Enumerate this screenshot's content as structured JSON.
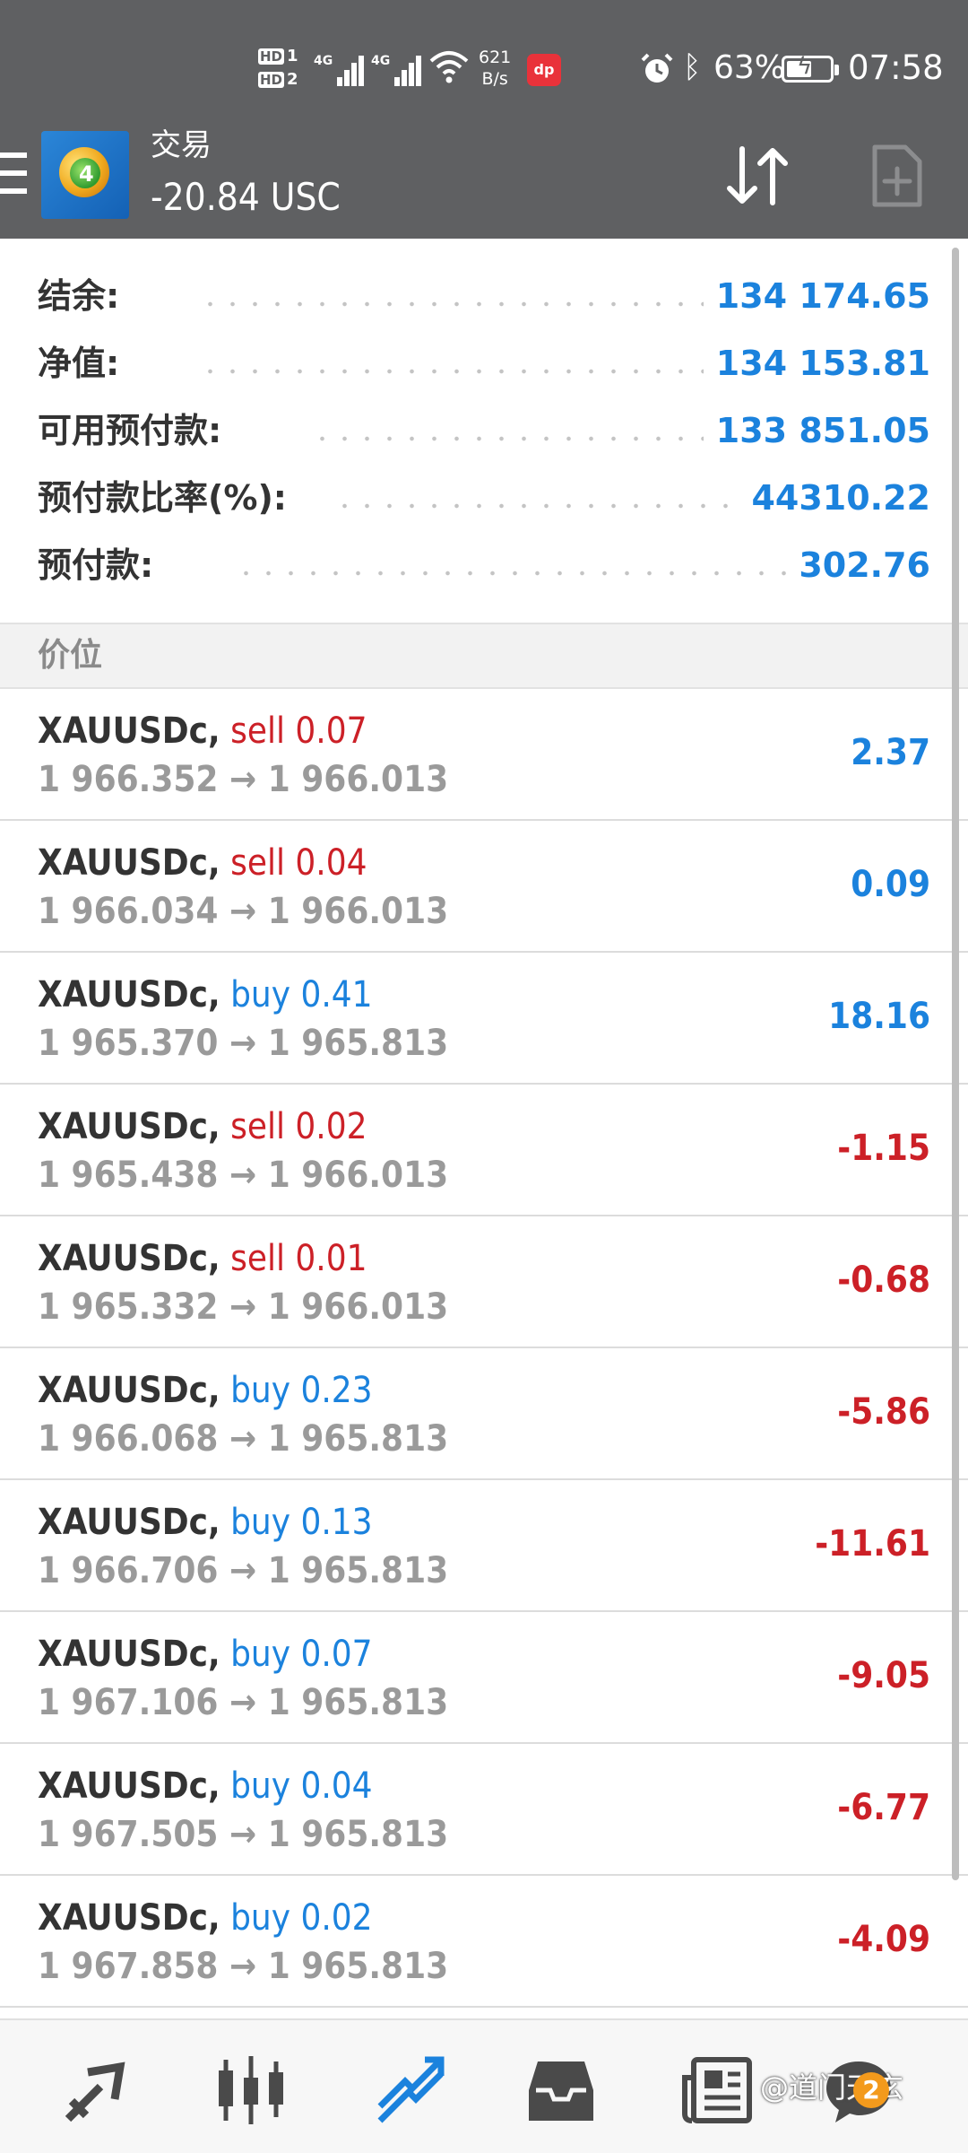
{
  "status_bar": {
    "hd1": "HD",
    "hd1_num": "1",
    "hd2": "HD",
    "hd2_num": "2",
    "net1": "4G",
    "net2": "4G",
    "speed_value": "621",
    "speed_unit": "B/s",
    "app_badge": "dp",
    "battery_pct": "63%",
    "battery_level": 0.63,
    "time": "07:58"
  },
  "toolbar": {
    "title": "交易",
    "balance": "-20.84 USC",
    "logo_num": "4"
  },
  "account": [
    {
      "label": "结余:",
      "value": "134 174.65"
    },
    {
      "label": "净值:",
      "value": "134 153.81"
    },
    {
      "label": "可用预付款:",
      "value": "133 851.05"
    },
    {
      "label": "预付款比率(%):",
      "value": "44310.22"
    },
    {
      "label": "预付款:",
      "value": "302.76"
    }
  ],
  "section_title": "价位",
  "positions": [
    {
      "symbol": "XAUUSDc,",
      "type": "sell",
      "lot": "0.07",
      "open": "1 966.352",
      "current": "1 966.013",
      "profit": "2.37",
      "sign": "pos"
    },
    {
      "symbol": "XAUUSDc,",
      "type": "sell",
      "lot": "0.04",
      "open": "1 966.034",
      "current": "1 966.013",
      "profit": "0.09",
      "sign": "pos"
    },
    {
      "symbol": "XAUUSDc,",
      "type": "buy",
      "lot": "0.41",
      "open": "1 965.370",
      "current": "1 965.813",
      "profit": "18.16",
      "sign": "pos"
    },
    {
      "symbol": "XAUUSDc,",
      "type": "sell",
      "lot": "0.02",
      "open": "1 965.438",
      "current": "1 966.013",
      "profit": "-1.15",
      "sign": "neg"
    },
    {
      "symbol": "XAUUSDc,",
      "type": "sell",
      "lot": "0.01",
      "open": "1 965.332",
      "current": "1 966.013",
      "profit": "-0.68",
      "sign": "neg"
    },
    {
      "symbol": "XAUUSDc,",
      "type": "buy",
      "lot": "0.23",
      "open": "1 966.068",
      "current": "1 965.813",
      "profit": "-5.86",
      "sign": "neg"
    },
    {
      "symbol": "XAUUSDc,",
      "type": "buy",
      "lot": "0.13",
      "open": "1 966.706",
      "current": "1 965.813",
      "profit": "-11.61",
      "sign": "neg"
    },
    {
      "symbol": "XAUUSDc,",
      "type": "buy",
      "lot": "0.07",
      "open": "1 967.106",
      "current": "1 965.813",
      "profit": "-9.05",
      "sign": "neg"
    },
    {
      "symbol": "XAUUSDc,",
      "type": "buy",
      "lot": "0.04",
      "open": "1 967.505",
      "current": "1 965.813",
      "profit": "-6.77",
      "sign": "neg"
    },
    {
      "symbol": "XAUUSDc,",
      "type": "buy",
      "lot": "0.02",
      "open": "1 967.858",
      "current": "1 965.813",
      "profit": "-4.09",
      "sign": "neg"
    }
  ],
  "arrow": "→",
  "bottom_nav": [
    {
      "name": "quotes-icon"
    },
    {
      "name": "chart-icon"
    },
    {
      "name": "trade-icon",
      "active": true
    },
    {
      "name": "history-icon"
    },
    {
      "name": "news-icon"
    },
    {
      "name": "messages-icon"
    }
  ],
  "watermark": "@道门天玄",
  "watermark_badge": "2",
  "colors": {
    "header_bg": "#5f6062",
    "value_blue": "#1b82dd",
    "sell_red": "#cc2027",
    "buy_blue": "#1b82dd",
    "muted_gray": "#9a9a9a",
    "active_nav": "#1b82dd",
    "inactive_nav": "#4a4a4a"
  }
}
